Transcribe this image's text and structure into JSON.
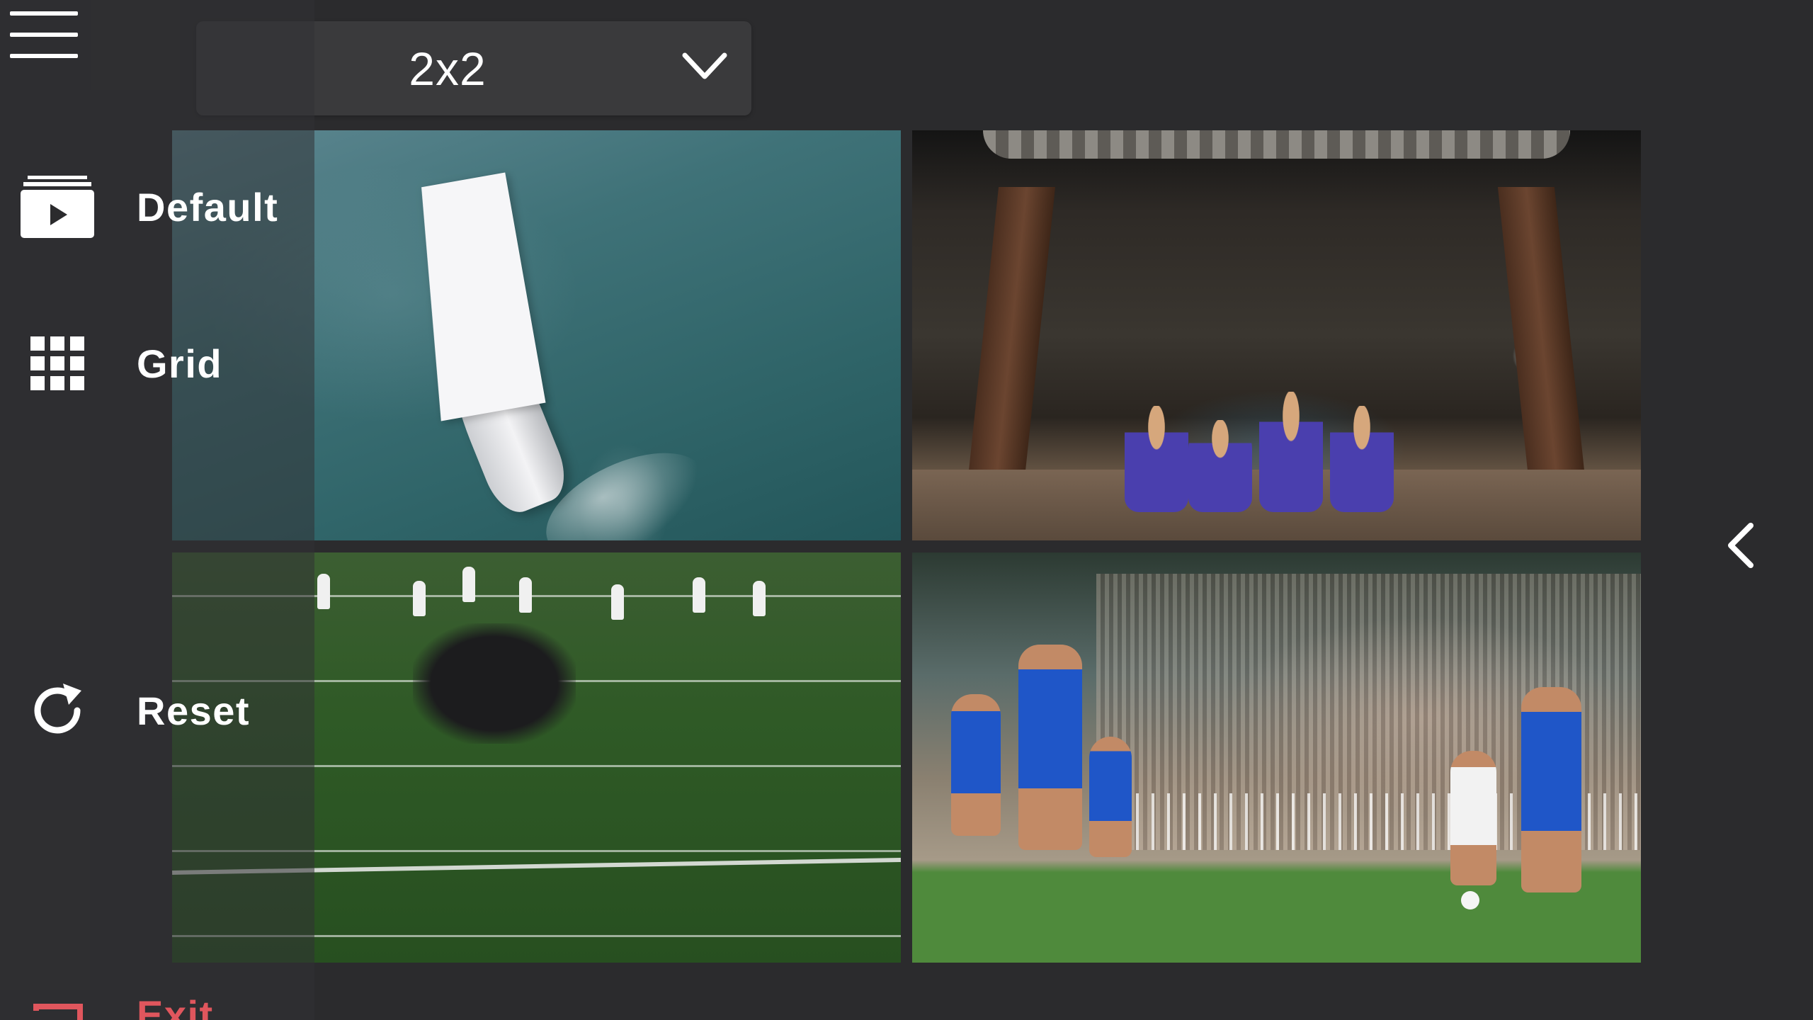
{
  "app": {
    "background": "#2b2b2d"
  },
  "layout_selector": {
    "value": "2x2",
    "icon": "chevron-down-icon"
  },
  "sidebar": {
    "menu_icon": "hamburger-menu-icon",
    "items": [
      {
        "id": "default",
        "label": "Default",
        "icon": "play-video-icon"
      },
      {
        "id": "grid",
        "label": "Grid",
        "icon": "grid-icon"
      },
      {
        "id": "reset",
        "label": "Reset",
        "icon": "refresh-icon"
      },
      {
        "id": "exit",
        "label": "Exit",
        "icon": "exit-icon",
        "color": "#e0565d"
      }
    ]
  },
  "video_grid": {
    "layout": "2x2",
    "tiles": [
      {
        "id": "tile-1",
        "scene": "aerial sailboat on ocean"
      },
      {
        "id": "tile-2",
        "scene": "dancers on theater stage"
      },
      {
        "id": "tile-3",
        "scene": "american football huddle on field"
      },
      {
        "id": "tile-4",
        "scene": "soccer match with players in blue"
      }
    ]
  },
  "collapse_control": {
    "icon": "chevron-left-icon"
  }
}
